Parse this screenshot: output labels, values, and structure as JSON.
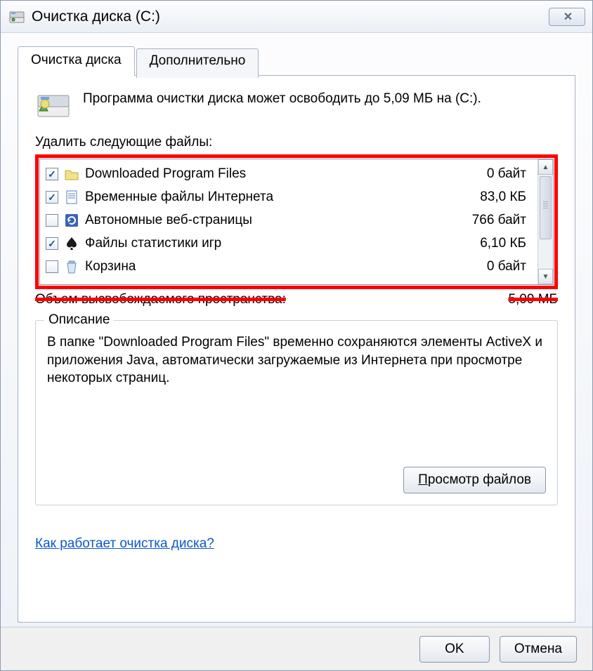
{
  "window": {
    "title": "Очистка диска  (C:)"
  },
  "tabs": {
    "main": "Очистка диска",
    "advanced": "Дополнительно"
  },
  "intro": "Программа очистки диска может освободить до 5,09 МБ на  (C:).",
  "files_label": "Удалить следующие файлы:",
  "files": [
    {
      "checked": true,
      "icon": "folder",
      "name": "Downloaded Program Files",
      "size": "0 байт"
    },
    {
      "checked": true,
      "icon": "doc",
      "name": "Временные файлы Интернета",
      "size": "83,0 КБ"
    },
    {
      "checked": false,
      "icon": "refresh",
      "name": "Автономные веб-страницы",
      "size": "766 байт"
    },
    {
      "checked": true,
      "icon": "spade",
      "name": "Файлы статистики игр",
      "size": "6,10 КБ"
    },
    {
      "checked": false,
      "icon": "bin",
      "name": "Корзина",
      "size": "0 байт"
    }
  ],
  "total": {
    "label": "Объем высвобождаемого пространства:",
    "value": "5,09 МБ"
  },
  "description": {
    "title": "Описание",
    "text": "В папке \"Downloaded Program Files\" временно сохраняются элементы ActiveX и приложения Java, автоматически загружаемые из Интернета при просмотре некоторых страниц."
  },
  "buttons": {
    "view_files": "Просмотр файлов",
    "view_files_hotkey": "П",
    "ok": "OK",
    "cancel": "Отмена"
  },
  "help_link": "Как работает очистка диска?"
}
